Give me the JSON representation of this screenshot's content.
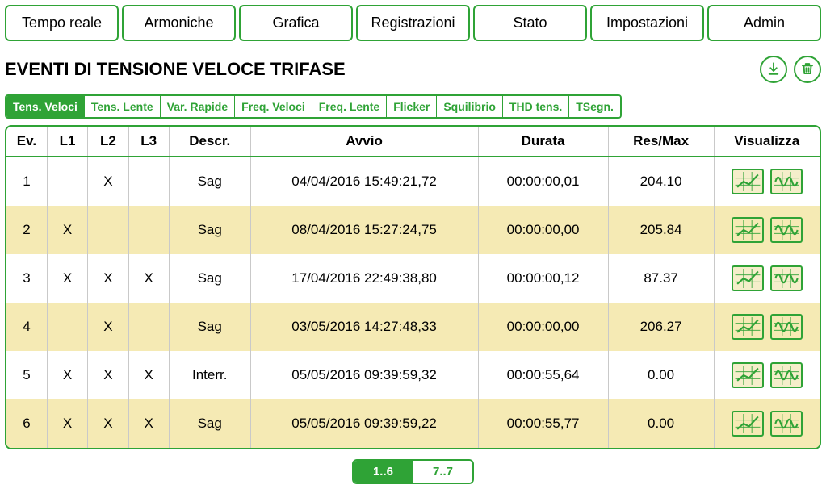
{
  "nav": [
    "Tempo reale",
    "Armoniche",
    "Grafica",
    "Registrazioni",
    "Stato",
    "Impostazioni",
    "Admin"
  ],
  "title": "EVENTI DI TENSIONE VELOCE TRIFASE",
  "sub_tabs": [
    "Tens. Veloci",
    "Tens. Lente",
    "Var. Rapide",
    "Freq. Veloci",
    "Freq. Lente",
    "Flicker",
    "Squilibrio",
    "THD tens.",
    "TSegn."
  ],
  "active_sub_tab": 0,
  "columns": [
    "Ev.",
    "L1",
    "L2",
    "L3",
    "Descr.",
    "Avvio",
    "Durata",
    "Res/Max",
    "Visualizza"
  ],
  "rows": [
    {
      "ev": "1",
      "l1": "",
      "l2": "X",
      "l3": "",
      "descr": "Sag",
      "avvio": "04/04/2016 15:49:21,72",
      "durata": "00:00:00,01",
      "res": "204.10"
    },
    {
      "ev": "2",
      "l1": "X",
      "l2": "",
      "l3": "",
      "descr": "Sag",
      "avvio": "08/04/2016 15:27:24,75",
      "durata": "00:00:00,00",
      "res": "205.84"
    },
    {
      "ev": "3",
      "l1": "X",
      "l2": "X",
      "l3": "X",
      "descr": "Sag",
      "avvio": "17/04/2016 22:49:38,80",
      "durata": "00:00:00,12",
      "res": "87.37"
    },
    {
      "ev": "4",
      "l1": "",
      "l2": "X",
      "l3": "",
      "descr": "Sag",
      "avvio": "03/05/2016 14:27:48,33",
      "durata": "00:00:00,00",
      "res": "206.27"
    },
    {
      "ev": "5",
      "l1": "X",
      "l2": "X",
      "l3": "X",
      "descr": "Interr.",
      "avvio": "05/05/2016 09:39:59,32",
      "durata": "00:00:55,64",
      "res": "0.00"
    },
    {
      "ev": "6",
      "l1": "X",
      "l2": "X",
      "l3": "X",
      "descr": "Sag",
      "avvio": "05/05/2016 09:39:59,22",
      "durata": "00:00:55,77",
      "res": "0.00"
    }
  ],
  "pager": {
    "active": "1..6",
    "next": "7..7"
  }
}
